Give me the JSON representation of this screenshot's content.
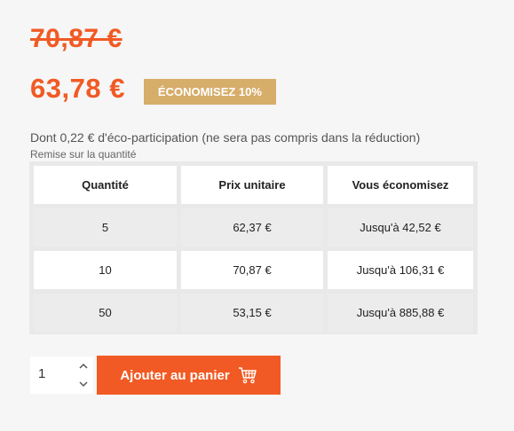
{
  "product": {
    "old_price": "70,87 €",
    "price": "63,78 €",
    "discount_badge": "ÉCONOMISEZ 10%",
    "eco_note": "Dont 0,22 € d'éco-participation (ne sera pas compris dans la réduction)"
  },
  "quantity_discount": {
    "title": "Remise sur la quantité",
    "headers": [
      "Quantité",
      "Prix unitaire",
      "Vous économisez"
    ],
    "rows": [
      {
        "qty": "5",
        "unit_price": "62,37 €",
        "savings": "Jusqu'à 42,52 €"
      },
      {
        "qty": "10",
        "unit_price": "70,87 €",
        "savings": "Jusqu'à 106,31 €"
      },
      {
        "qty": "50",
        "unit_price": "53,15 €",
        "savings": "Jusqu'à 885,88 €"
      }
    ]
  },
  "cart": {
    "quantity_value": "1",
    "add_button_label": "Ajouter au panier",
    "button_icon": "cart-icon",
    "spinner_icons": [
      "chevron-up-icon",
      "chevron-down-icon"
    ]
  },
  "colors": {
    "accent": "#f15a24",
    "badge": "#d7ad6a",
    "background": "#f6f6f6"
  }
}
